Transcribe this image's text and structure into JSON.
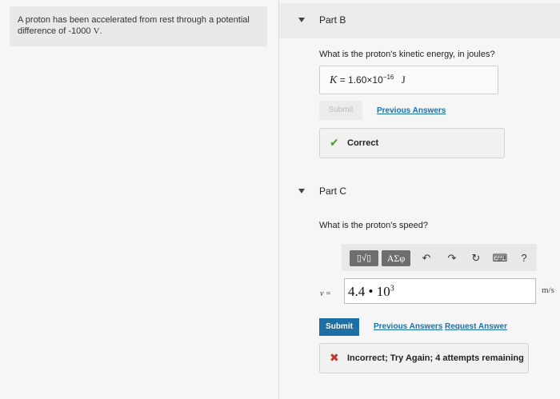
{
  "problem": {
    "text_prefix": "A proton has been accelerated from rest through a potential difference of ",
    "value": "-1000",
    "unit": "V",
    "suffix": "."
  },
  "part_b": {
    "label": "Part B",
    "question": "What is the proton's kinetic energy, in joules?",
    "answer_var": "K",
    "answer_eq": "=",
    "answer_mantissa": "1.60×10",
    "answer_exp": "−16",
    "answer_unit": "J",
    "submit_label": "Submit",
    "previous_answers_label": "Previous Answers",
    "feedback_text": "Correct",
    "feedback_icon": "check-icon"
  },
  "part_c": {
    "label": "Part C",
    "question": "What is the proton's speed?",
    "toolbar": {
      "templates_label": "▯√▯",
      "greek_label": "ΑΣφ",
      "undo_icon": "↶",
      "redo_icon": "↷",
      "reset_icon": "↻",
      "keyboard_icon": "⌨",
      "help_icon": "?"
    },
    "var_label": "v =",
    "input_mantissa": "4.4 • 10",
    "input_exp": "3",
    "units": "m/s",
    "submit_label": "Submit",
    "previous_answers_label": "Previous Answers",
    "request_answer_label": "Request Answer",
    "feedback_text": "Incorrect; Try Again; 4 attempts remaining",
    "feedback_icon": "x-icon"
  },
  "colors": {
    "link": "#1d6fa5",
    "submit": "#1d6fa5",
    "correct": "#4a9a2a",
    "incorrect": "#c0392b"
  }
}
